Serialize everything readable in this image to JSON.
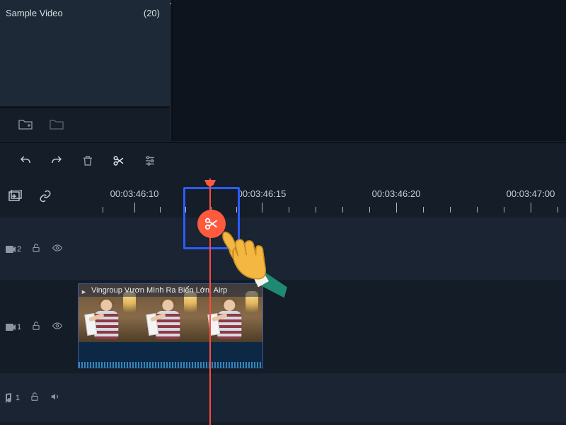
{
  "media": {
    "sample_label": "Sample Video",
    "sample_count": "(20)"
  },
  "toolbar": {
    "undo": "undo",
    "redo": "redo",
    "delete": "delete",
    "split": "split",
    "adjust": "adjust"
  },
  "ruler": {
    "add_track": "add-track",
    "link": "link",
    "labels": [
      "00:03:46:10",
      "00:03:46:15",
      "00:03:46:20",
      "00:03:47:00"
    ]
  },
  "tracks": {
    "v2": {
      "label": "2"
    },
    "v1": {
      "label": "1"
    },
    "a1": {
      "label": "1"
    }
  },
  "clip": {
    "title": "Vingroup Vươn Mình Ra Biển Lớn, Airp"
  },
  "colors": {
    "playhead": "#ff4a3d",
    "highlight_box": "#2a5cff",
    "split_marker_bg": "#ff5a3d"
  }
}
